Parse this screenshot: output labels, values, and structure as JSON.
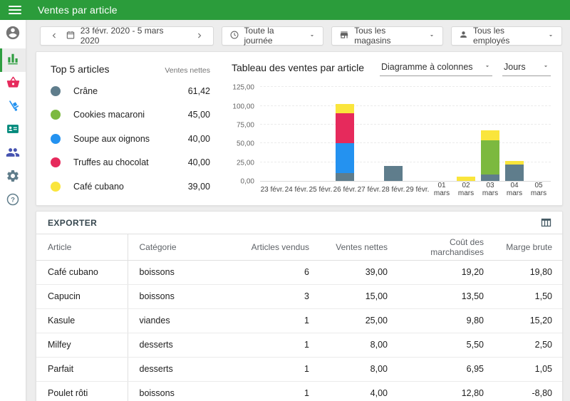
{
  "header": {
    "title": "Ventes par article",
    "color": "#2b9c3b"
  },
  "sidebar": {
    "items": [
      {
        "id": "account",
        "icon": "account-circle-icon",
        "color": "#757575",
        "active": false
      },
      {
        "id": "reports",
        "icon": "bar-chart-icon",
        "color": "#2f9e41",
        "active": true
      },
      {
        "id": "items",
        "icon": "basket-icon",
        "color": "#e62a5c",
        "active": false
      },
      {
        "id": "inventory",
        "icon": "hand-truck-icon",
        "color": "#2492f0",
        "active": false
      },
      {
        "id": "employees",
        "icon": "id-card-icon",
        "color": "#00897b",
        "active": false
      },
      {
        "id": "customers",
        "icon": "people-icon",
        "color": "#4653b0",
        "active": false
      },
      {
        "id": "settings",
        "icon": "gear-icon",
        "color": "#607d8b",
        "active": false
      },
      {
        "id": "help",
        "icon": "help-icon",
        "color": "#607d8b",
        "active": false
      }
    ]
  },
  "toolbar": {
    "date_range": "23 févr. 2020 - 5 mars 2020",
    "time_filter": "Toute la journée",
    "store_filter": "Tous les magasins",
    "employee_filter": "Tous les employés"
  },
  "top5": {
    "title": "Top 5 articles",
    "value_header": "Ventes nettes",
    "items": [
      {
        "label": "Crâne",
        "value": "61,42",
        "color": "#5f7d8c"
      },
      {
        "label": "Cookies macaroni",
        "value": "45,00",
        "color": "#7cb93f"
      },
      {
        "label": "Soupe aux oignons",
        "value": "40,00",
        "color": "#2492f0"
      },
      {
        "label": "Truffes au chocolat",
        "value": "40,00",
        "color": "#e62a5c"
      },
      {
        "label": "Café cubano",
        "value": "39,00",
        "color": "#fae53c"
      }
    ]
  },
  "chart": {
    "title": "Tableau des ventes par article",
    "type_select": "Diagramme à colonnes",
    "period_select": "Jours"
  },
  "chart_data": {
    "type": "bar",
    "stacked": true,
    "title": "Tableau des ventes par article",
    "categories": [
      "23 févr.",
      "24 févr.",
      "25 févr.",
      "26 févr.",
      "27 févr.",
      "28 févr.",
      "29 févr.",
      "01 mars",
      "02 mars",
      "03 mars",
      "04 mars",
      "05 mars"
    ],
    "series": [
      {
        "name": "Crâne",
        "color": "#5f7d8c",
        "values": [
          0,
          0,
          0,
          10,
          0,
          20,
          0,
          0,
          0,
          9,
          22,
          0
        ]
      },
      {
        "name": "Cookies macaroni",
        "color": "#7cb93f",
        "values": [
          0,
          0,
          0,
          0,
          0,
          0,
          0,
          0,
          0,
          45,
          0,
          0
        ]
      },
      {
        "name": "Soupe aux oignons",
        "color": "#2492f0",
        "values": [
          0,
          0,
          0,
          40,
          0,
          0,
          0,
          0,
          0,
          0,
          0,
          0
        ]
      },
      {
        "name": "Truffes au chocolat",
        "color": "#e62a5c",
        "values": [
          0,
          0,
          0,
          40,
          0,
          0,
          0,
          0,
          0,
          0,
          0,
          0
        ]
      },
      {
        "name": "Café cubano",
        "color": "#fae53c",
        "values": [
          0,
          0,
          0,
          12,
          0,
          0,
          0,
          0,
          6,
          13,
          5,
          0
        ]
      }
    ],
    "ylim": [
      0,
      125
    ],
    "ytick_step": 25,
    "ytick_labels": [
      "0,00",
      "25,00",
      "50,00",
      "75,00",
      "100,00",
      "125,00"
    ],
    "grid": true,
    "legend": "none"
  },
  "table": {
    "export_label": "EXPORTER",
    "columns": [
      "Article",
      "Catégorie",
      "Articles vendus",
      "Ventes nettes",
      "Coût des marchandises",
      "Marge brute"
    ],
    "rows": [
      [
        "Café cubano",
        "boissons",
        "6",
        "39,00",
        "19,20",
        "19,80"
      ],
      [
        "Capucin",
        "boissons",
        "3",
        "15,00",
        "13,50",
        "1,50"
      ],
      [
        "Kasule",
        "viandes",
        "1",
        "25,00",
        "9,80",
        "15,20"
      ],
      [
        "Milfey",
        "desserts",
        "1",
        "8,00",
        "5,50",
        "2,50"
      ],
      [
        "Parfait",
        "desserts",
        "1",
        "8,00",
        "6,95",
        "1,05"
      ],
      [
        "Poulet rôti",
        "boissons",
        "1",
        "4,00",
        "12,80",
        "-8,80"
      ]
    ]
  }
}
